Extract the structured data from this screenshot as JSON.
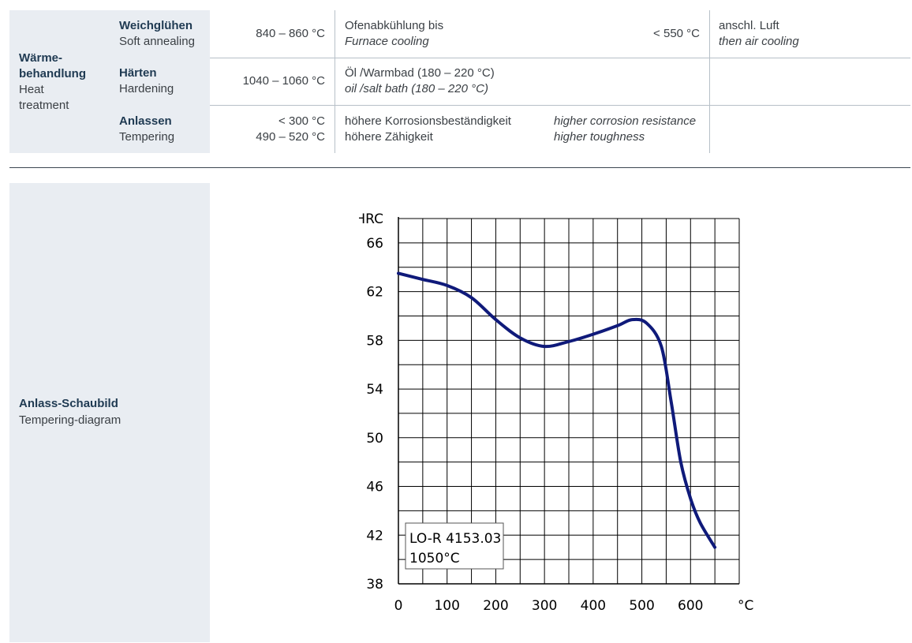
{
  "heat_treatment": {
    "label_de_1": "Wärme-",
    "label_de_2": "behandlung",
    "label_en_1": "Heat",
    "label_en_2": "treatment",
    "rows": [
      {
        "name_de": "Weichglühen",
        "name_en": "Soft annealing",
        "temp": "840 – 860 °C",
        "note_de": "Ofenabkühlung bis",
        "note_en": "Furnace cooling",
        "limit": "< 550 °C",
        "after_de": "anschl. Luft",
        "after_en": "then air cooling"
      },
      {
        "name_de": "Härten",
        "name_en": "Hardening",
        "temp": "1040 – 1060 °C",
        "note_de": "Öl /Warmbad (180 – 220 °C)",
        "note_en": "oil /salt bath (180 – 220 °C)"
      },
      {
        "name_de": "Anlassen",
        "name_en": "Tempering",
        "temp_1": "< 300 °C",
        "temp_2": "490 – 520 °C",
        "note_de_1": "höhere Korrosionsbeständigkeit",
        "note_de_2": "höhere Zähigkeit",
        "note_en_1": "higher corrosion resistance",
        "note_en_2": "higher toughness"
      }
    ]
  },
  "diagram": {
    "label_de": "Anlass-Schaubild",
    "label_en": "Tempering-diagram"
  },
  "chart_data": {
    "type": "line",
    "ylabel": "HRC",
    "xunit": "°C",
    "xlim": [
      0,
      700
    ],
    "ylim": [
      38,
      68
    ],
    "xticks": [
      0,
      100,
      200,
      300,
      400,
      500,
      600
    ],
    "yticks": [
      38,
      42,
      46,
      50,
      54,
      58,
      62,
      66
    ],
    "grid": true,
    "legend_line_1": "LO-R 4153.03",
    "legend_line_2": "1050°C",
    "legend_position": "bottom-left",
    "line_color": "#0f1a7a",
    "series": [
      {
        "x": [
          0,
          50,
          100,
          150,
          200,
          250,
          300,
          350,
          400,
          450,
          480,
          510,
          540,
          560,
          580,
          600,
          620,
          650
        ],
        "y": [
          63.5,
          63.0,
          62.5,
          61.5,
          59.7,
          58.2,
          57.5,
          57.9,
          58.5,
          59.2,
          59.7,
          59.4,
          57.5,
          53.0,
          48.0,
          45.0,
          43.0,
          41.0
        ]
      }
    ]
  }
}
